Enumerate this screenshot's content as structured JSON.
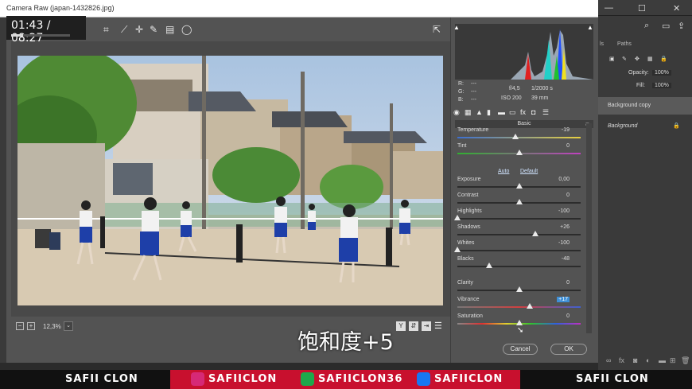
{
  "window": {
    "title": "Camera Raw (japan-1432826.jpg)"
  },
  "video": {
    "timestamp": "01:43 / 08:27",
    "progress": 0.2
  },
  "photoshop": {
    "tabs": [
      "ls",
      "Paths"
    ],
    "opacity_label": "Opacity:",
    "opacity": "100%",
    "fill_label": "Fill:",
    "fill": "100%",
    "layers": [
      {
        "name": "Background copy"
      },
      {
        "name": "Background"
      }
    ]
  },
  "preview": {
    "zoom": "12,3%"
  },
  "caption": "饱和度+5",
  "info": {
    "r": "R:",
    "r_val": "---",
    "g": "G:",
    "g_val": "---",
    "b": "B:",
    "b_val": "---",
    "aperture": "f/4,5",
    "shutter": "1/2000 s",
    "iso": "ISO 200",
    "focal": "39 mm"
  },
  "panel": {
    "header": "Basic",
    "auto": "Auto",
    "default": "Default"
  },
  "sliders": [
    {
      "label": "Temperature",
      "value": "-19",
      "level": 0.47
    },
    {
      "label": "Tint",
      "value": "0",
      "level": 0.5
    },
    {
      "label": "Exposure",
      "value": "0,00",
      "level": 0.5
    },
    {
      "label": "Contrast",
      "value": "0",
      "level": 0.5
    },
    {
      "label": "Highlights",
      "value": "-100",
      "level": 0.0
    },
    {
      "label": "Shadows",
      "value": "+26",
      "level": 0.63
    },
    {
      "label": "Whites",
      "value": "-100",
      "level": 0.0
    },
    {
      "label": "Blacks",
      "value": "-48",
      "level": 0.26
    },
    {
      "label": "Clarity",
      "value": "0",
      "level": 0.5
    },
    {
      "label": "Vibrance",
      "value": "+17",
      "level": 0.585,
      "highlight": true
    },
    {
      "label": "Saturation",
      "value": "0",
      "level": 0.5
    }
  ],
  "buttons": {
    "cancel": "Cancel",
    "ok": "OK"
  },
  "banner": {
    "left": "SAFII CLON",
    "instagram": "SAFIICLON",
    "green": "SAFIICLON36",
    "facebook": "SAFIICLON",
    "right": "SAFII CLON"
  },
  "colors": {
    "accent": "#3e8fd6",
    "banner_red": "#c8102e"
  }
}
